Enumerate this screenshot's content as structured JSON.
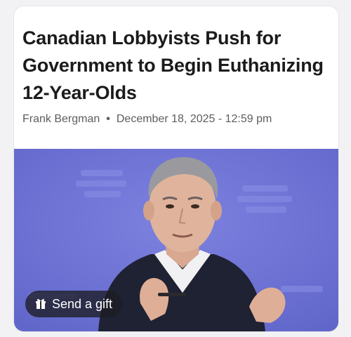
{
  "article": {
    "headline": "Canadian Lobbyists Push for Government to Begin Euthanizing 12-Year-Olds",
    "author": "Frank Bergman",
    "separator": "•",
    "date": "December 18, 2025 - 12:59 pm"
  },
  "photo": {
    "description_icon": "person-photo"
  },
  "actions": {
    "gift_label": "Send a gift",
    "gift_icon": "gift-icon"
  },
  "colors": {
    "photo_background": "#6e73d4",
    "headline": "#1b1b1b",
    "byline": "#5d5d60"
  }
}
